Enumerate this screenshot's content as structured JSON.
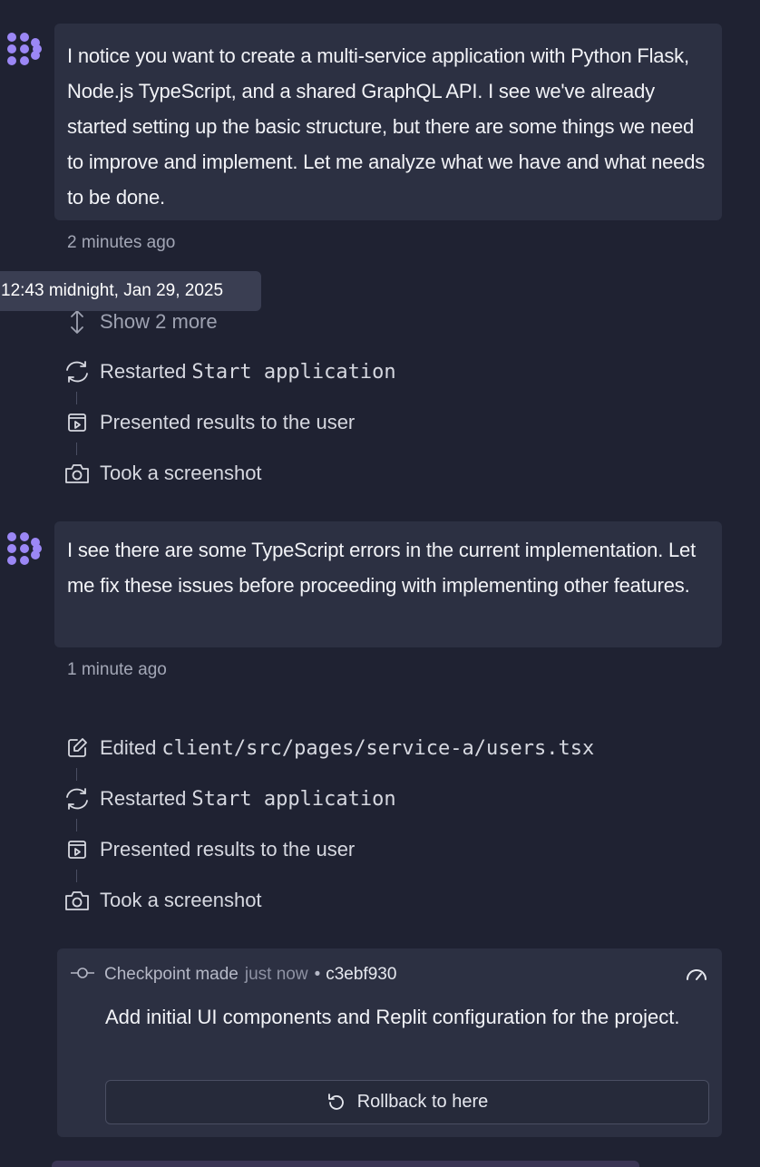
{
  "messages": [
    {
      "text": "I notice you want to create a multi-service application with Python Flask, Node.js TypeScript, and a shared GraphQL API. I see we've already started setting up the basic structure, but there are some things we need to improve and implement. Let me analyze what we have and what needs to be done.",
      "time_ago": "2 minutes ago",
      "tooltip": "12:43 midnight, Jan 29, 2025",
      "show_more": "Show 2 more",
      "actions": [
        {
          "icon": "restart-icon",
          "label": "Restarted",
          "code": "Start application"
        },
        {
          "icon": "present-icon",
          "label": "Presented results to the user",
          "code": ""
        },
        {
          "icon": "camera-icon",
          "label": "Took a screenshot",
          "code": ""
        }
      ]
    },
    {
      "text": "I see there are some TypeScript errors in the current implementation. Let me fix these issues before proceeding with implementing other features.",
      "time_ago": "1 minute ago",
      "actions": [
        {
          "icon": "edit-icon",
          "label": "Edited",
          "code": "client/src/pages/service-a/users.tsx"
        },
        {
          "icon": "restart-icon",
          "label": "Restarted",
          "code": "Start application"
        },
        {
          "icon": "present-icon",
          "label": "Presented results to the user",
          "code": ""
        },
        {
          "icon": "camera-icon",
          "label": "Took a screenshot",
          "code": ""
        }
      ]
    }
  ],
  "checkpoint": {
    "label": "Checkpoint made",
    "time": "just now",
    "separator": "•",
    "hash": "c3ebf930",
    "message": "Add initial UI components and Replit configuration for the project.",
    "rollback_label": "Rollback to here",
    "icons": [
      "commit-icon",
      "gauge-icon",
      "undo-icon"
    ]
  },
  "colors": {
    "background": "#1f2232",
    "bubble": "#2c3042",
    "avatar": "#9b87f5",
    "muted_text": "#a3a7b6"
  }
}
